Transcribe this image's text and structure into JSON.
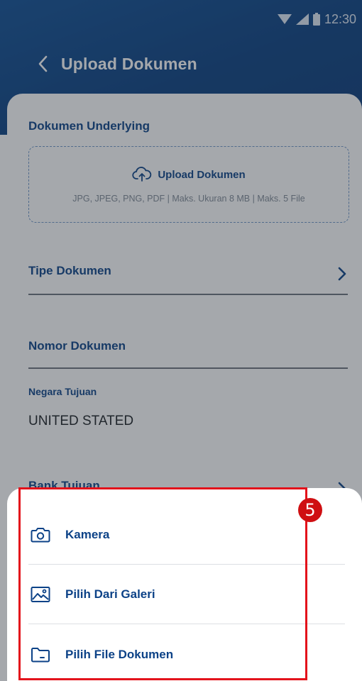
{
  "status_bar": {
    "time": "12:30"
  },
  "appbar": {
    "title": "Upload Dokumen"
  },
  "upload_section": {
    "title": "Dokumen Underlying",
    "button_label": "Upload Dokumen",
    "hint": "JPG, JPEG, PNG, PDF | Maks. Ukuran 8 MB | Maks. 5 File"
  },
  "fields": {
    "tipe_dokumen": "Tipe Dokumen",
    "nomor_dokumen": "Nomor Dokumen",
    "negara_tujuan_label": "Negara Tujuan",
    "negara_tujuan_value": "UNITED STATED",
    "bank_tujuan": "Bank Tujuan"
  },
  "sheet": {
    "items": [
      {
        "label": "Kamera",
        "icon": "camera-icon"
      },
      {
        "label": "Pilih Dari Galeri",
        "icon": "gallery-icon"
      },
      {
        "label": "Pilih File Dokumen",
        "icon": "folder-icon"
      }
    ]
  },
  "annotation": {
    "badge": "5"
  },
  "colors": {
    "header": "#0c4287",
    "accent": "#0c4287",
    "annotation": "#e3121b"
  }
}
